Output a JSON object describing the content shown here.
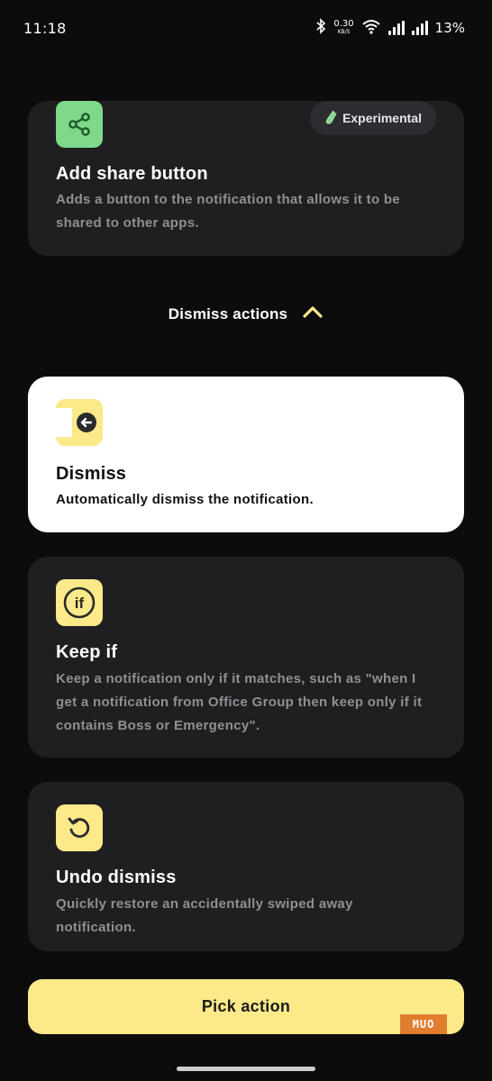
{
  "status_bar": {
    "time": "11:18",
    "net_speed_value": "0.30",
    "net_speed_unit": "KB/S",
    "battery": "13%"
  },
  "share_card": {
    "badge": "Experimental",
    "badge_icon": "test-tube-icon",
    "icon": "share-icon",
    "title": "Add share button",
    "description": "Adds a button to the notification that allows it to be shared to other apps."
  },
  "section": {
    "title": "Dismiss actions",
    "icon": "chevron-up-icon"
  },
  "actions": [
    {
      "icon": "dismiss-icon",
      "title": "Dismiss",
      "description": "Automatically dismiss the notification.",
      "selected": true
    },
    {
      "icon": "if-icon",
      "icon_text": "if",
      "title": "Keep if",
      "description": "Keep a notification only if it matches, such as \"when I get a notification from Office Group then keep only if it contains Boss or Emergency\".",
      "selected": false
    },
    {
      "icon": "undo-icon",
      "title": "Undo dismiss",
      "description": "Quickly restore an accidentally swiped away notification.",
      "selected": false
    }
  ],
  "footer": {
    "button_label": "Pick action",
    "watermark": "MUO"
  },
  "colors": {
    "background": "#0c0c0d",
    "card": "#1f1f22",
    "accent_yellow": "#fbe98a",
    "accent_green": "#7fd98a",
    "muted_text": "#8f8f94"
  }
}
